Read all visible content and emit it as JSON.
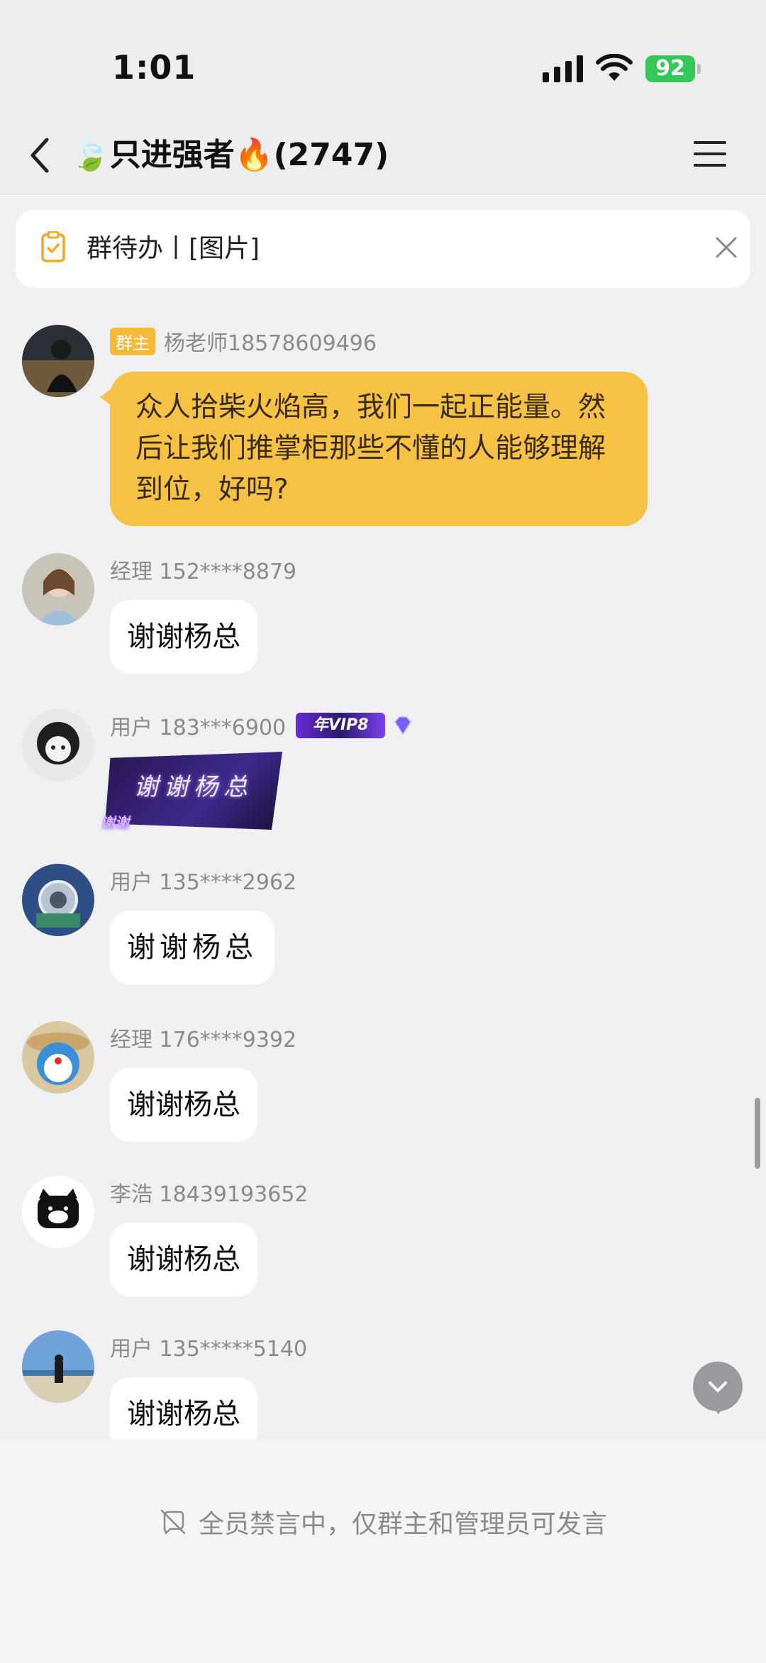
{
  "status": {
    "time": "1:01",
    "battery": "92"
  },
  "nav": {
    "title": "🍃只进强者🔥(2747)"
  },
  "todo": {
    "text": "群待办丨[图片]"
  },
  "messages": [
    {
      "badge": "群主",
      "name": "杨老师18578609496",
      "text": "众人拾柴火焰高，我们一起正能量。然后让我们推掌柜那些不懂的人能够理解到位，好吗?"
    },
    {
      "name": "经理 152****8879",
      "text": "谢谢杨总"
    },
    {
      "name": "用户 183***6900",
      "vip_label": "年VIP8",
      "sticker_text": "谢谢杨总",
      "sticker_tag": "谢谢"
    },
    {
      "name": "用户 135****2962",
      "text": "谢谢杨总"
    },
    {
      "name": "经理 176****9392",
      "text": "谢谢杨总"
    },
    {
      "name": "李浩 18439193652",
      "text": "谢谢杨总"
    },
    {
      "name": "用户 135*****5140",
      "text": "谢谢杨总"
    }
  ],
  "footer": {
    "muted_text": "全员禁言中，仅群主和管理员可发言"
  },
  "colors": {
    "accent_yellow": "#f5c243",
    "battery_green": "#34c759",
    "background": "#f0f0f2"
  }
}
